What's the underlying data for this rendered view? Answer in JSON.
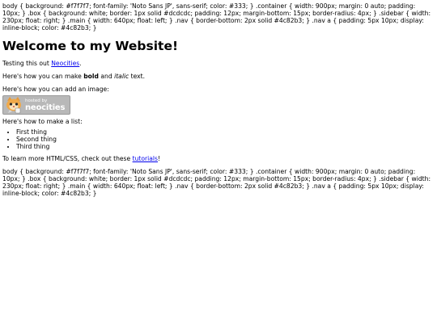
{
  "css_dump_top": "body { background: #f7f7f7; font-family: 'Noto Sans JP', sans-serif; color: #333; } .container { width: 900px; margin: 0 auto; padding: 10px; } .box { background: white; border: 1px solid #dcdcdc; padding: 12px; margin-bottom: 15px; border-radius: 4px; } .sidebar { width: 230px; float: right; } .main { width: 640px; float: left; } .nav { border-bottom: 2px solid #4c82b3; } .nav a { padding: 5px 10px; display: inline-block; color: #4c82b3; }",
  "heading": "Welcome to my Website!",
  "intro": {
    "prefix": "Testing this out ",
    "link": "Neocities",
    "suffix": "."
  },
  "formatting": {
    "prefix": "Here's how you can make ",
    "bold": "bold",
    "middle": " and ",
    "italic": "italic",
    "suffix": " text."
  },
  "image_intro": "Here's how you can add an image:",
  "badge": {
    "small": "hosted by",
    "big": "neocities",
    "icon": "neocities-cat-icon"
  },
  "list_intro": "Here's how to make a list:",
  "list_items": [
    "First thing",
    "Second thing",
    "Third thing"
  ],
  "learn": {
    "prefix": "To learn more HTML/CSS, check out these ",
    "link": "tutorials",
    "suffix": "!"
  },
  "css_dump_bottom": "body { background: #f7f7f7; font-family: 'Noto Sans JP', sans-serif; color: #333; } .container { width: 900px; margin: 0 auto; padding: 10px; } .box { background: white; border: 1px solid #dcdcdc; padding: 12px; margin-bottom: 15px; border-radius: 4px; } .sidebar { width: 230px; float: right; } .main { width: 640px; float: left; } .nav { border-bottom: 2px solid #4c82b3; } .nav a { padding: 5px 10px; display: inline-block; color: #4c82b3; }",
  "colors": {
    "link": "#0000ee",
    "text": "#000000",
    "badge_bg": "#b8b8b8"
  }
}
